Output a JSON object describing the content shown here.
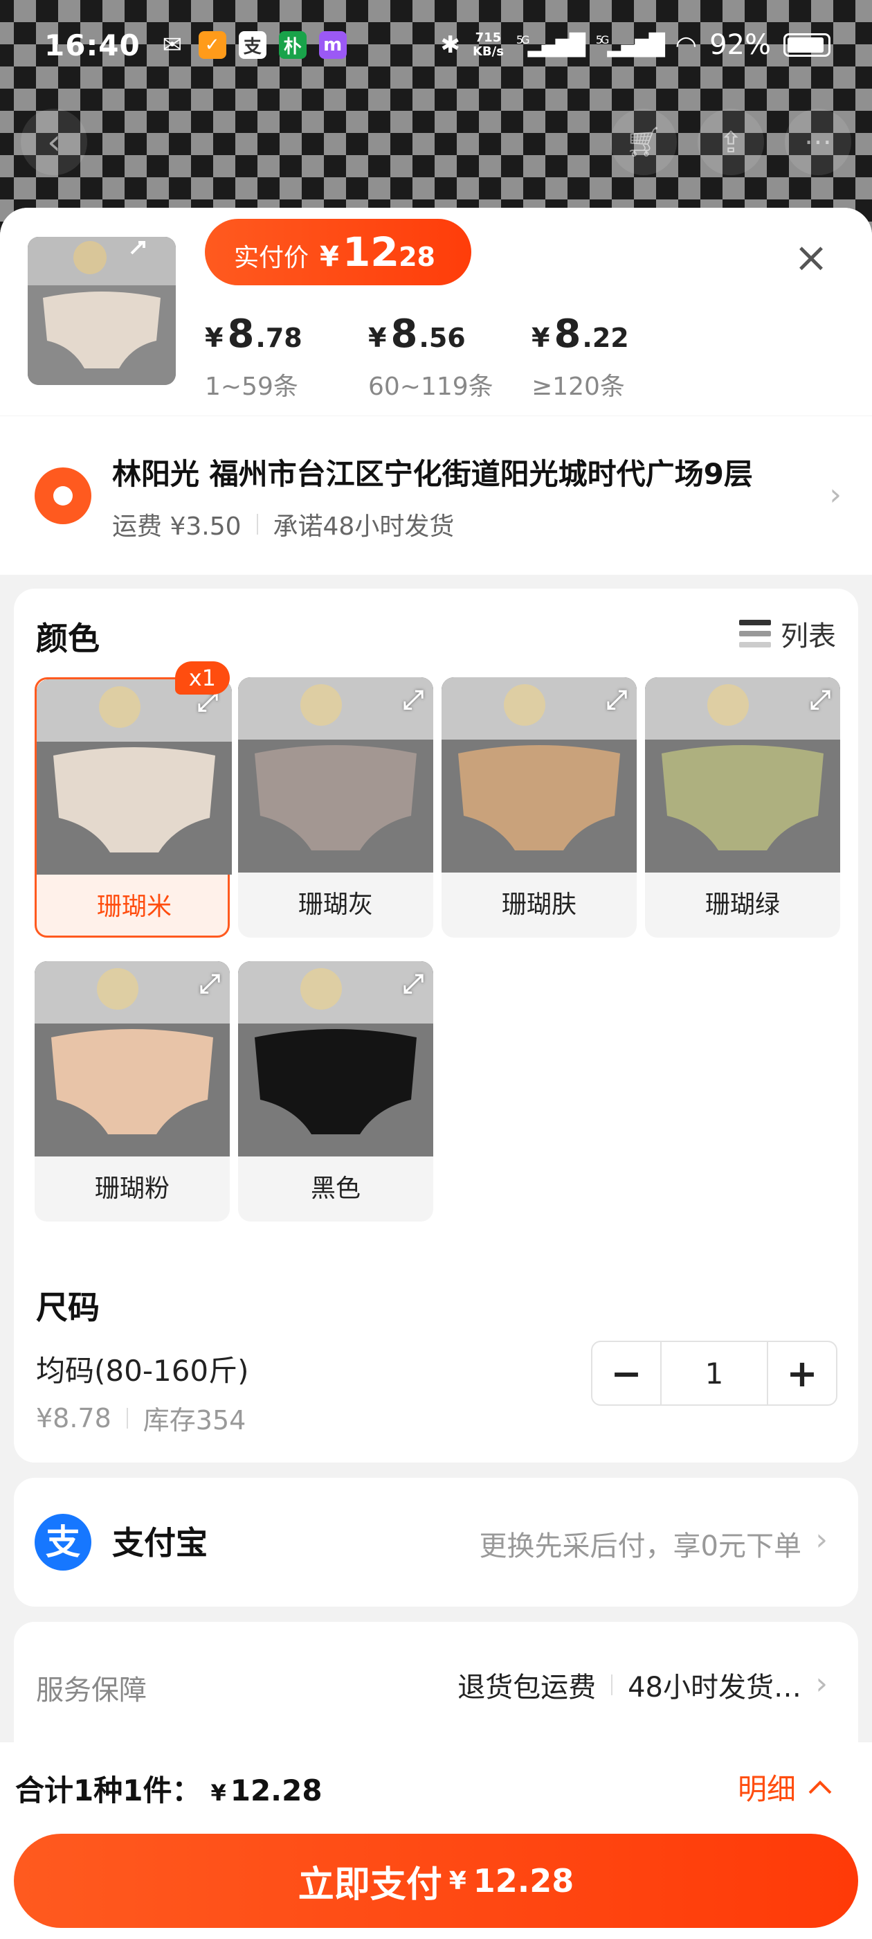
{
  "status_bar": {
    "time": "16:40",
    "speed_value": "715",
    "speed_unit": "KB/s",
    "network_a": "5G",
    "network_b": "5G",
    "battery": "92%",
    "battery_level": 0.92
  },
  "header": {
    "paid_price_label": "实付价",
    "paid_price_currency": "¥",
    "paid_price_int": "12",
    "paid_price_dec": ".28",
    "tiers": [
      {
        "currency": "¥",
        "int": "8",
        "dec": ".78",
        "range": "1~59条"
      },
      {
        "currency": "¥",
        "int": "8",
        "dec": ".56",
        "range": "60~119条"
      },
      {
        "currency": "¥",
        "int": "8",
        "dec": ".22",
        "range": "≥120条"
      }
    ]
  },
  "address": {
    "name_line": "林阳光 福州市台江区宁化街道阳光城时代广场9层",
    "shipping": "运费 ¥3.50",
    "promise": "承诺48小时发货"
  },
  "color_section": {
    "title": "颜色",
    "list_toggle": "列表",
    "selected_badge": "x1",
    "options": [
      {
        "name": "珊瑚米",
        "swatch": "#e4d9cd",
        "selected": true
      },
      {
        "name": "珊瑚灰",
        "swatch": "#a39792",
        "selected": false
      },
      {
        "name": "珊瑚肤",
        "swatch": "#c9a27b",
        "selected": false
      },
      {
        "name": "珊瑚绿",
        "swatch": "#aeb07f",
        "selected": false
      },
      {
        "name": "珊瑚粉",
        "swatch": "#e8c4a8",
        "selected": false
      },
      {
        "name": "黑色",
        "swatch": "#141414",
        "selected": false
      }
    ]
  },
  "size_section": {
    "title": "尺码",
    "size_name": "均码(80-160斤)",
    "price": "¥8.78",
    "stock": "库存354",
    "quantity": "1",
    "minus": "−",
    "plus": "+"
  },
  "payment": {
    "method": "支付宝",
    "icon_glyph": "支",
    "hint": "更换先采后付，享0元下单"
  },
  "service": {
    "title": "服务保障",
    "item1": "退货包运费",
    "item2": "48小时发货…"
  },
  "footer": {
    "total_label": "合计1种1件：",
    "total_currency": "¥",
    "total_amount": "12.28",
    "detail_label": "明细",
    "pay_label": "立即支付",
    "pay_currency": "¥",
    "pay_amount": "12.28"
  },
  "colors": {
    "accent": "#ff4d0f",
    "alipay_blue": "#1677ff"
  }
}
